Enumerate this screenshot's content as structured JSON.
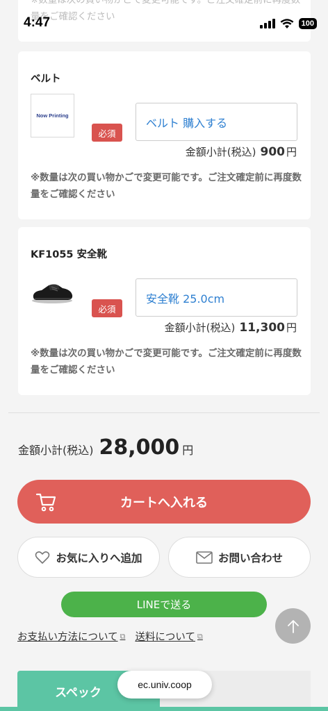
{
  "status": {
    "time": "4:47",
    "battery": "100"
  },
  "products": [
    {
      "note": "※数量は次の買い物かごで変更可能です。ご注文確定前に再度数量をご確認ください"
    },
    {
      "name": "ベルト",
      "image_label": "Now Printing",
      "required": "必須",
      "option": "ベルト 購入する",
      "subtotal_label": "金額小計(税込)",
      "subtotal_amount": "900",
      "yen": "円",
      "note": "※数量は次の買い物かごで変更可能です。ご注文確定前に再度数量をご確認ください"
    },
    {
      "name": "KF1055 安全靴",
      "required": "必須",
      "option": "安全靴 25.0cm",
      "subtotal_label": "金額小計(税込)",
      "subtotal_amount": "11,300",
      "yen": "円",
      "note": "※数量は次の買い物かごで変更可能です。ご注文確定前に再度数量をご確認ください"
    }
  ],
  "total": {
    "label": "金額小計(税込)",
    "amount": "28,000",
    "yen": "円"
  },
  "actions": {
    "cart": "カートへ入れる",
    "favorite": "お気に入りへ追加",
    "contact": "お問い合わせ",
    "line": "LINEで送る"
  },
  "links": {
    "payment": "お支払い方法について",
    "shipping": "送料について"
  },
  "tabs": {
    "spec": "スペック"
  },
  "browser": {
    "url": "ec.univ.coop"
  },
  "colors": {
    "accent_red": "#e0605a",
    "line_green": "#4cb24a",
    "tab_green": "#5cc5a4",
    "option_blue": "#2f80d1"
  }
}
